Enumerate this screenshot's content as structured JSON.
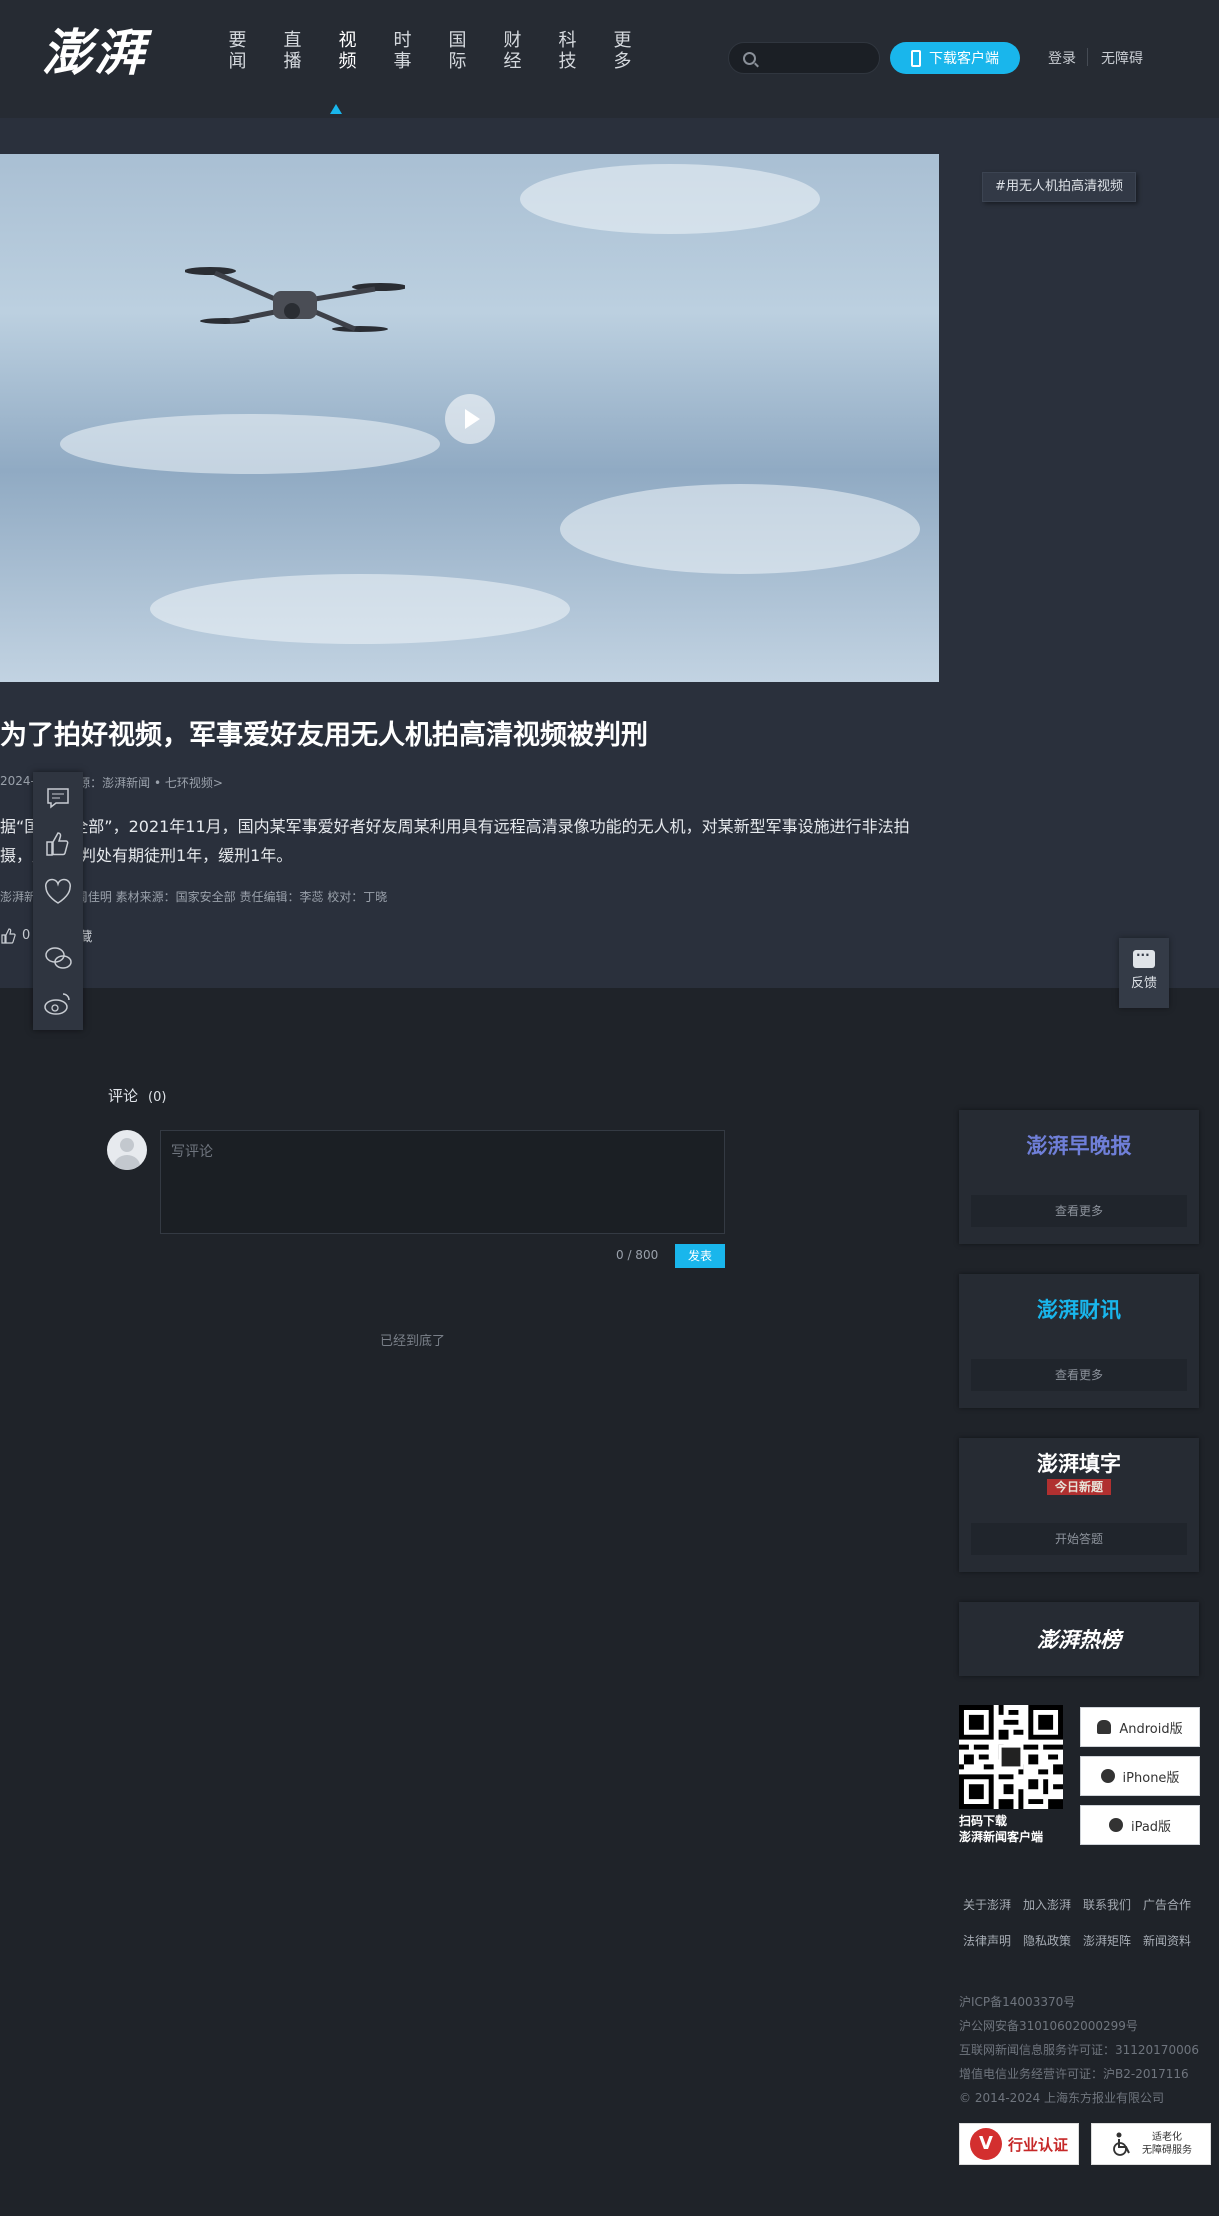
{
  "header": {
    "logo": "澎湃",
    "nav": [
      {
        "line1": "要",
        "line2": "闻"
      },
      {
        "line1": "直",
        "line2": "播"
      },
      {
        "line1": "视",
        "line2": "频"
      },
      {
        "line1": "时",
        "line2": "事"
      },
      {
        "line1": "国",
        "line2": "际"
      },
      {
        "line1": "财",
        "line2": "经"
      },
      {
        "line1": "科",
        "line2": "技"
      },
      {
        "line1": "更",
        "line2": "多"
      }
    ],
    "search_placeholder": "",
    "download_label": "下载客户端",
    "login_label": "登录",
    "accessibility_label": "无障碍"
  },
  "article": {
    "tag": "#用无人机拍高清视频",
    "title": "为了拍好视频，军事爱好友用无人机拍高清视频被判刑",
    "meta_date": "2024-0",
    "meta_time": "1",
    "meta_source": "来源：澎湃新闻 • 七环视频>",
    "body": "据“国家安全部”，2021年11月，国内某军事爱好者好友周某利用具有远程高清录像功能的无人机，对某新型军事设施进行非法拍摄，周某被判处有期徒刑1年，缓刑1年。",
    "credits": "澎湃新闻记者 周佳明 素材来源：国家安全部  责任编辑：李蕊  校对：丁晓",
    "like_count": "0",
    "favorite_label": "收藏",
    "feedback_label": "反馈"
  },
  "comments": {
    "title": "评论",
    "count": "(0)",
    "placeholder": "写评论",
    "char_count": "0 / 800",
    "publish_label": "发表",
    "bottom_note": "已经到底了"
  },
  "sidebar": {
    "cards": [
      {
        "logo": "澎湃早晚报",
        "logo_color": "#6f7fd8",
        "button": "查看更多"
      },
      {
        "logo": "澎湃财讯",
        "logo_color": "#19b6ec",
        "button": "查看更多"
      },
      {
        "logo": "澎湃填字",
        "sub": "今日新题",
        "logo_color": "#ffffff",
        "button": "开始答题"
      },
      {
        "logo": "澎湃热榜",
        "logo_color": "#ffffff"
      }
    ],
    "qr_caption_line1": "扫码下载",
    "qr_caption_line2": "澎湃新闻客户端",
    "apps": [
      "Android版",
      "iPhone版",
      "iPad版"
    ]
  },
  "footer": {
    "links_row1": [
      "关于澎湃",
      "加入澎湃",
      "联系我们",
      "广告合作"
    ],
    "links_row2": [
      "法律声明",
      "隐私政策",
      "澎湃矩阵",
      "新闻资料"
    ],
    "legal": [
      "沪ICP备14003370号",
      "沪公网安备31010602000299号",
      "互联网新闻信息服务许可证：31120170006",
      "增值电信业务经营许可证：沪B2-2017116",
      "© 2014-2024 上海东方报业有限公司"
    ],
    "badge1": "行业认证",
    "badge2_line1": "适老化",
    "badge2_line2": "无障碍服务"
  }
}
